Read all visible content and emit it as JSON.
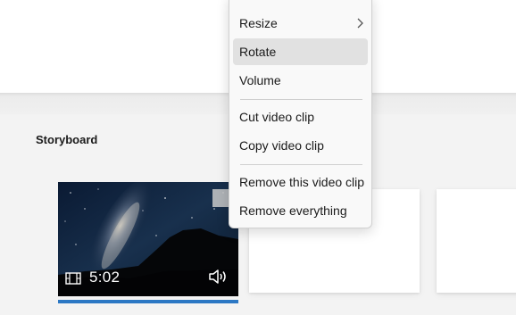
{
  "storyboard": {
    "title": "Storyboard",
    "clip": {
      "duration": "5:02",
      "thumbnail": "milky-way-mountain-night-sky",
      "progress": 1.0
    }
  },
  "context_menu": {
    "items": [
      {
        "label": "Resize",
        "has_submenu": true
      },
      {
        "label": "Rotate",
        "highlighted": true
      },
      {
        "label": "Volume"
      },
      {
        "label": "Cut video clip"
      },
      {
        "label": "Copy video clip"
      },
      {
        "label": "Remove this video clip"
      },
      {
        "label": "Remove everything"
      }
    ]
  },
  "colors": {
    "accent": "#2c78c4",
    "menu_bg": "#f9f9f9",
    "menu_highlight": "#e1e1e1",
    "canvas_bg": "#f3f3f3"
  },
  "icons": {
    "submenu": "chevron-right-icon",
    "clip_duration": "film-strip-icon",
    "clip_volume": "speaker-icon"
  }
}
